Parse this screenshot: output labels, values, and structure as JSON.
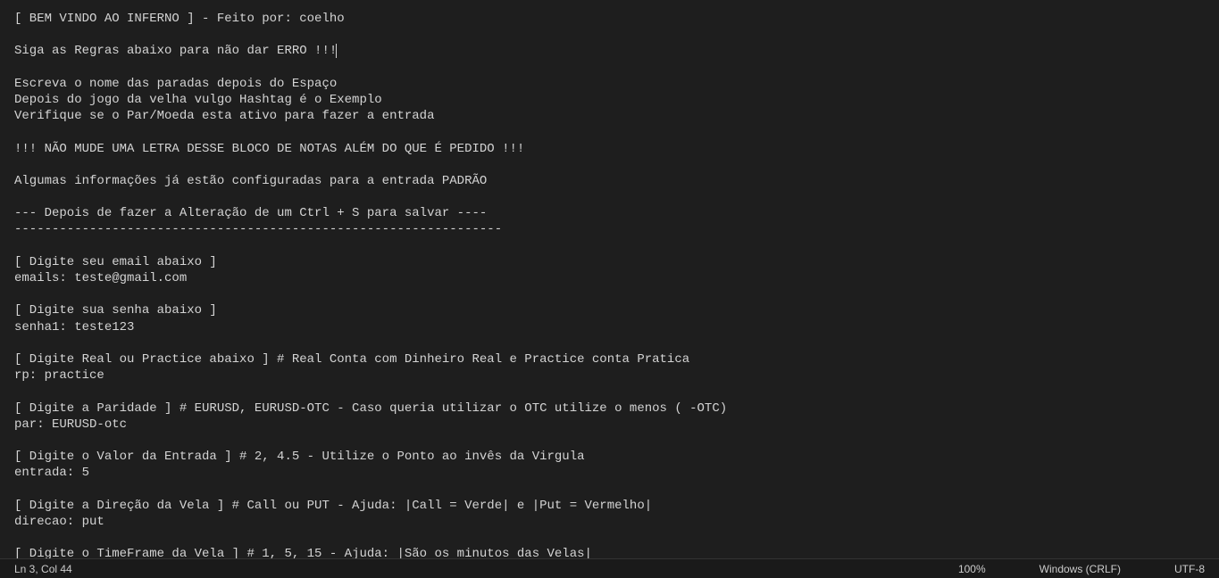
{
  "editor": {
    "lines": [
      "[ BEM VINDO AO INFERNO ] - Feito por: coelho",
      "",
      "Siga as Regras abaixo para não dar ERRO !!!",
      "",
      "Escreva o nome das paradas depois do Espaço",
      "Depois do jogo da velha vulgo Hashtag é o Exemplo",
      "Verifique se o Par/Moeda esta ativo para fazer a entrada",
      "",
      "!!! NÃO MUDE UMA LETRA DESSE BLOCO DE NOTAS ALÉM DO QUE É PEDIDO !!!",
      "",
      "Algumas informações já estão configuradas para a entrada PADRÃO",
      "",
      "--- Depois de fazer a Alteração de um Ctrl + S para salvar ----",
      "-----------------------------------------------------------------",
      "",
      "[ Digite seu email abaixo ]",
      "emails: teste@gmail.com",
      "",
      "[ Digite sua senha abaixo ]",
      "senha1: teste123",
      "",
      "[ Digite Real ou Practice abaixo ] # Real Conta com Dinheiro Real e Practice conta Pratica",
      "rp: practice",
      "",
      "[ Digite a Paridade ] # EURUSD, EURUSD-OTC - Caso queria utilizar o OTC utilize o menos ( -OTC)",
      "par: EURUSD-otc",
      "",
      "[ Digite o Valor da Entrada ] # 2, 4.5 - Utilize o Ponto ao invês da Virgula",
      "entrada: 5",
      "",
      "[ Digite a Direção da Vela ] # Call ou PUT - Ajuda: |Call = Verde| e |Put = Vermelho|",
      "direcao: put",
      "",
      "[ Digite o TimeFrame da Vela ] # 1, 5, 15 - Ajuda: |São os minutos das Velas|"
    ],
    "cursorLine": 2
  },
  "statusBar": {
    "position": "Ln 3, Col 44",
    "zoom": "100%",
    "lineEnding": "Windows (CRLF)",
    "encoding": "UTF-8"
  }
}
